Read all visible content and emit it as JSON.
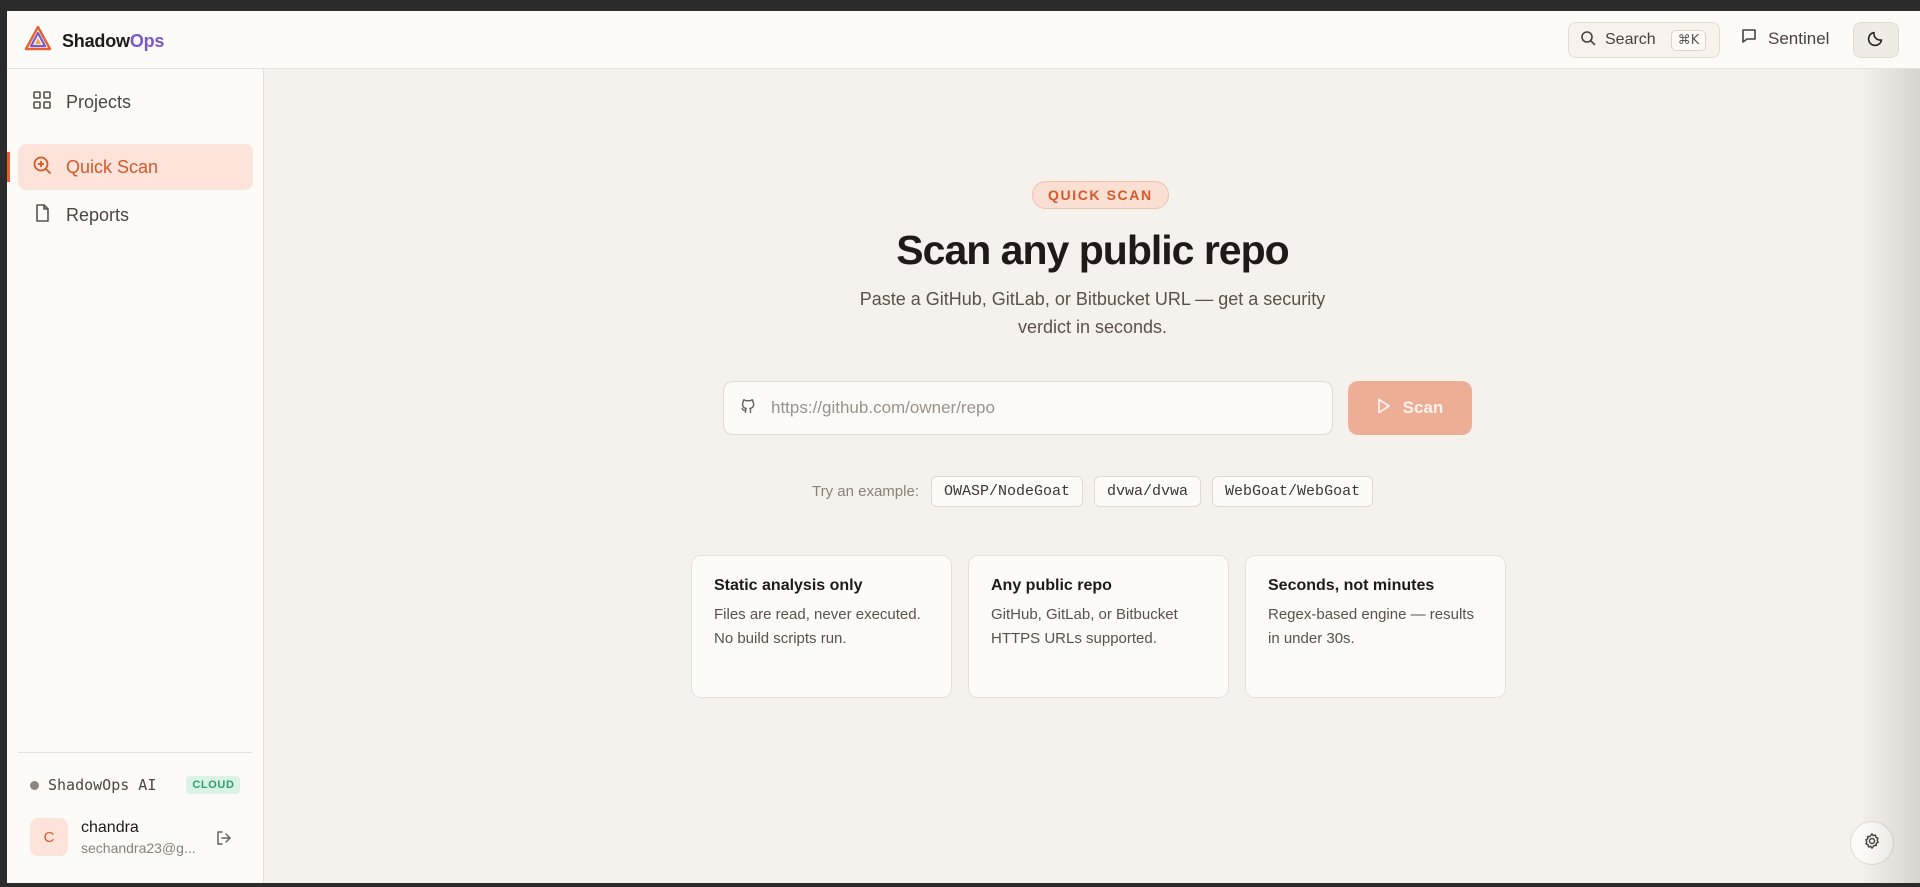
{
  "brand": {
    "name_main": "Shadow",
    "name_accent": "Ops"
  },
  "topbar": {
    "search_label": "Search",
    "search_shortcut": "⌘K",
    "sentinel_label": "Sentinel"
  },
  "sidebar": {
    "items": [
      {
        "label": "Projects",
        "icon": "grid-icon",
        "active": false
      },
      {
        "label": "Quick Scan",
        "icon": "search-plus-icon",
        "active": true
      },
      {
        "label": "Reports",
        "icon": "file-icon",
        "active": false
      }
    ],
    "ai_status": {
      "label": "ShadowOps AI",
      "badge": "CLOUD"
    },
    "user": {
      "initial": "C",
      "name": "chandra",
      "email": "sechandra23@g..."
    }
  },
  "main": {
    "pill": "QUICK SCAN",
    "headline": "Scan any public repo",
    "subtitle": "Paste a GitHub, GitLab, or Bitbucket URL — get a security verdict in seconds.",
    "url_placeholder": "https://github.com/owner/repo",
    "url_value": "",
    "scan_label": "Scan",
    "examples_label": "Try an example:",
    "examples": [
      "OWASP/NodeGoat",
      "dvwa/dvwa",
      "WebGoat/WebGoat"
    ],
    "cards": [
      {
        "title": "Static analysis only",
        "body": "Files are read, never executed. No build scripts run."
      },
      {
        "title": "Any public repo",
        "body": "GitHub, GitLab, or Bitbucket HTTPS URLs supported."
      },
      {
        "title": "Seconds, not minutes",
        "body": "Regex-based engine — results in under 30s."
      }
    ]
  },
  "colors": {
    "accent": "#e5612f",
    "accent_soft": "#fde3d9",
    "scan_button": "#eeae95",
    "ai_badge": "#2f9f6c"
  }
}
